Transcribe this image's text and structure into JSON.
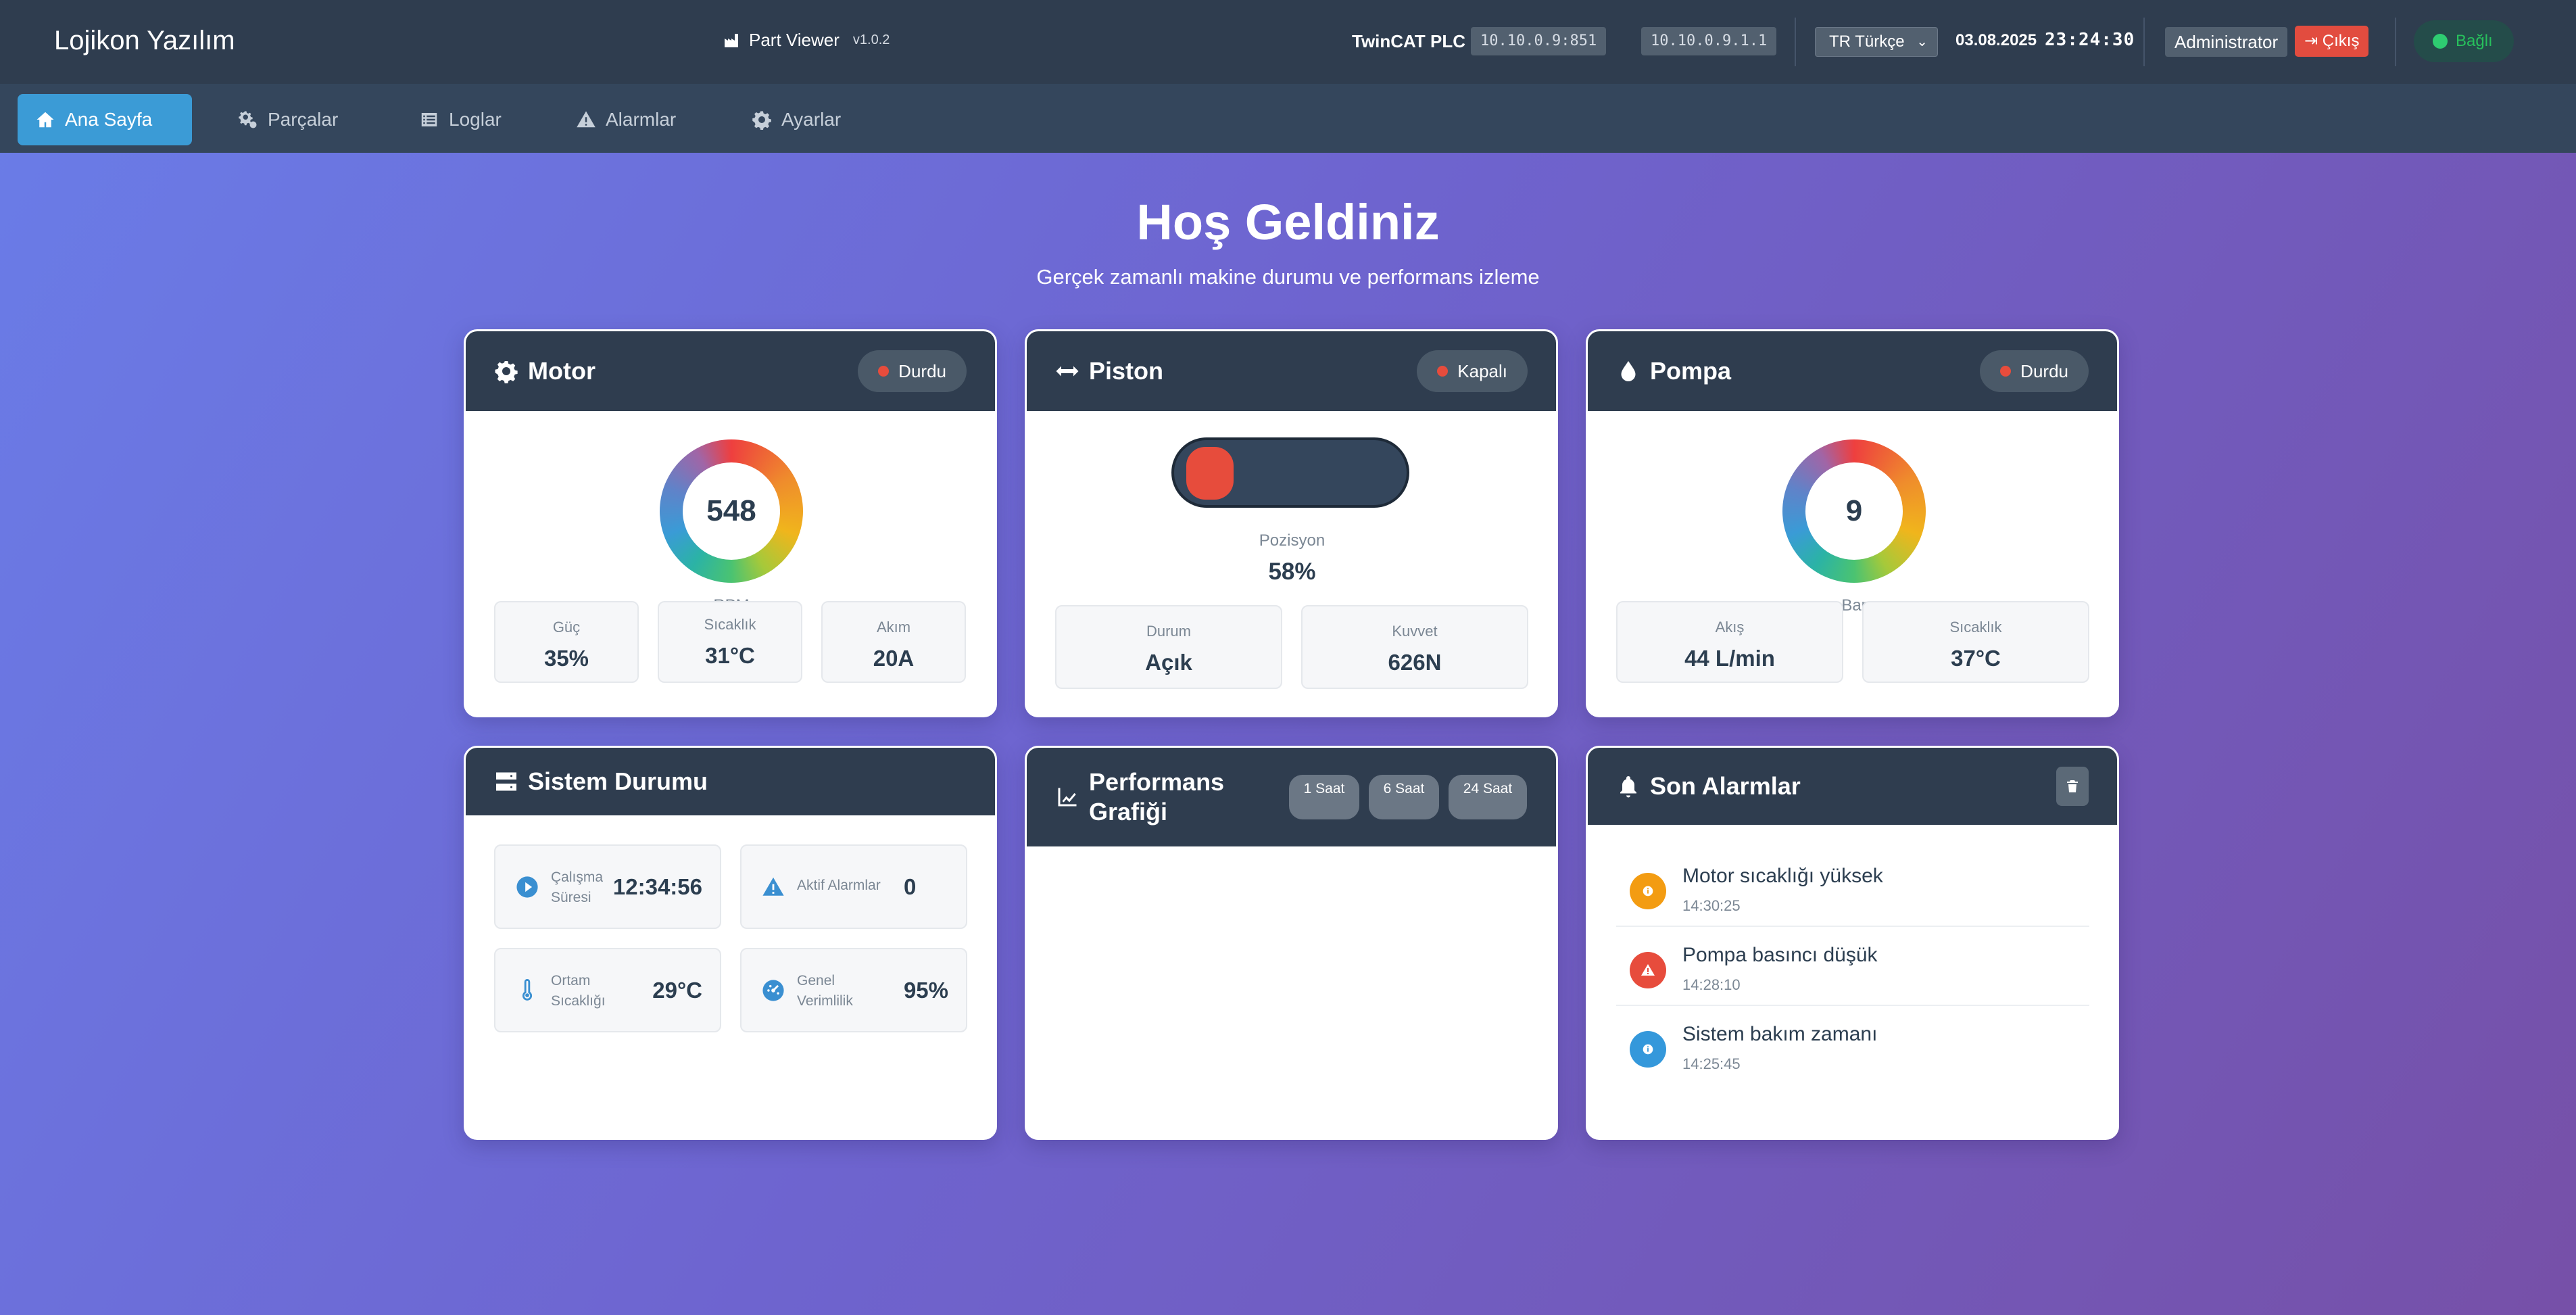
{
  "header": {
    "brand": "Lojikon Yazılım",
    "app_name": "Part Viewer",
    "app_version": "v1.0.2",
    "plc_label": "TwinCAT PLC",
    "ip_primary": "10.10.0.9:851",
    "ip_secondary": "10.10.0.9.1.1",
    "language": "TR Türkçe",
    "date": "03.08.2025",
    "time": "23:24:30",
    "user": "Administrator",
    "logout": "Çıkış",
    "connection": "Bağlı"
  },
  "nav": [
    {
      "label": "Ana Sayfa",
      "icon": "home-icon",
      "active": true
    },
    {
      "label": "Parçalar",
      "icon": "cogs-icon",
      "active": false
    },
    {
      "label": "Loglar",
      "icon": "list-icon",
      "active": false
    },
    {
      "label": "Alarmlar",
      "icon": "warning-icon",
      "active": false
    },
    {
      "label": "Ayarlar",
      "icon": "gear-icon",
      "active": false
    }
  ],
  "hero": {
    "title": "Hoş Geldiniz",
    "subtitle": "Gerçek zamanlı makine durumu ve performans izleme"
  },
  "motor": {
    "title": "Motor",
    "status": "Durdu",
    "gauge_value": "548",
    "gauge_unit": "RPM",
    "stats": [
      {
        "label": "Güç",
        "value": "35%"
      },
      {
        "label": "Sıcaklık",
        "value": "31°C"
      },
      {
        "label": "Akım",
        "value": "20A"
      }
    ]
  },
  "piston": {
    "title": "Piston",
    "status": "Kapalı",
    "position_label": "Pozisyon",
    "position_value": "58%",
    "stats": [
      {
        "label": "Durum",
        "value": "Açık"
      },
      {
        "label": "Kuvvet",
        "value": "626N"
      }
    ]
  },
  "pump": {
    "title": "Pompa",
    "status": "Durdu",
    "gauge_value": "9",
    "gauge_unit": "Bar",
    "stats": [
      {
        "label": "Akış",
        "value": "44 L/min"
      },
      {
        "label": "Sıcaklık",
        "value": "37°C"
      }
    ]
  },
  "system": {
    "title": "Sistem Durumu",
    "tiles": [
      {
        "label": "Çalışma Süresi",
        "value": "12:34:56",
        "icon": "play-circle-icon"
      },
      {
        "label": "Aktif Alarmlar",
        "value": "0",
        "icon": "warning-icon"
      },
      {
        "label": "Ortam Sıcaklığı",
        "value": "29°C",
        "icon": "thermometer-icon"
      },
      {
        "label": "Genel Verimlilik",
        "value": "95%",
        "icon": "speedometer-icon"
      }
    ]
  },
  "performance": {
    "title": "Performans Grafiği",
    "ranges": [
      "1 Saat",
      "6 Saat",
      "24 Saat"
    ]
  },
  "alarms": {
    "title": "Son Alarmlar",
    "items": [
      {
        "message": "Motor sıcaklığı yüksek",
        "time": "14:30:25",
        "level": "info",
        "color": "#f39c12"
      },
      {
        "message": "Pompa basıncı düşük",
        "time": "14:28:10",
        "level": "warning",
        "color": "#e74c3c"
      },
      {
        "message": "Sistem bakım zamanı",
        "time": "14:25:45",
        "level": "info",
        "color": "#3498db"
      }
    ]
  },
  "colors": {
    "header_bg": "#2f3d4f",
    "nav_bg": "#34465c",
    "accent": "#3b9bd6",
    "danger": "#e74c3c",
    "success": "#2ecc71"
  }
}
